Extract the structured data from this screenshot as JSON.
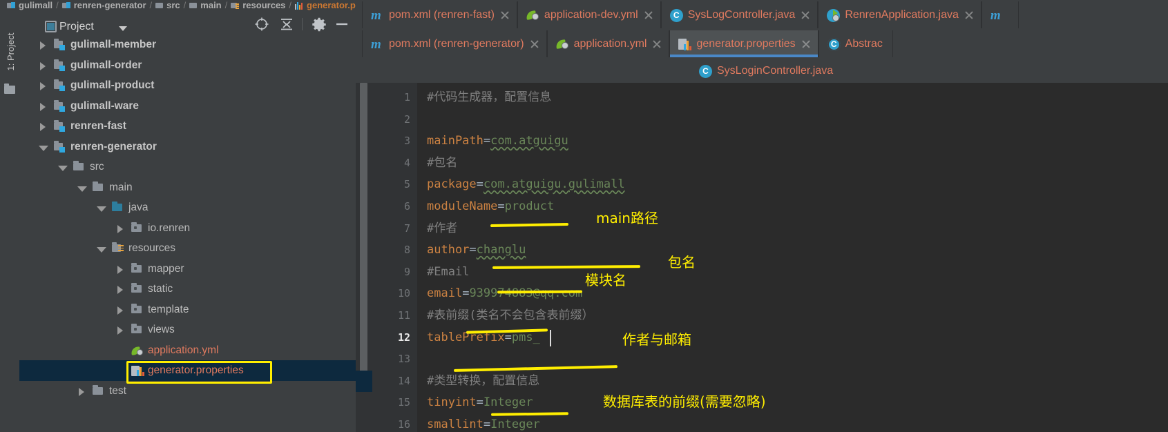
{
  "breadcrumb": {
    "items": [
      {
        "label": "gulimall",
        "icon": "module-icon"
      },
      {
        "label": "renren-generator",
        "icon": "module-icon"
      },
      {
        "label": "src",
        "icon": "folder-icon"
      },
      {
        "label": "main",
        "icon": "folder-icon"
      },
      {
        "label": "resources",
        "icon": "resources-folder-icon"
      },
      {
        "label": "generator.properties",
        "icon": "properties-file-icon"
      }
    ],
    "separator": "/"
  },
  "tool_window_strip": {
    "label": "1: Project",
    "underlined_char": "1",
    "folder_icon": "folder-icon"
  },
  "project_panel": {
    "title": "Project",
    "dropdown_icon": "chevron-down-icon",
    "toolbar_icons": [
      {
        "name": "locate-icon"
      },
      {
        "name": "collapse-all-icon"
      },
      {
        "name": "gear-icon"
      },
      {
        "name": "minimize-icon"
      }
    ],
    "tree": [
      {
        "label": "gulimall-member",
        "depth": 1,
        "arrow": "collapsed",
        "icon": "module-icon",
        "style": "bold"
      },
      {
        "label": "gulimall-order",
        "depth": 1,
        "arrow": "collapsed",
        "icon": "module-icon",
        "style": "bold"
      },
      {
        "label": "gulimall-product",
        "depth": 1,
        "arrow": "collapsed",
        "icon": "module-icon",
        "style": "bold"
      },
      {
        "label": "gulimall-ware",
        "depth": 1,
        "arrow": "collapsed",
        "icon": "module-icon",
        "style": "bold"
      },
      {
        "label": "renren-fast",
        "depth": 1,
        "arrow": "collapsed",
        "icon": "module-icon",
        "style": "bold"
      },
      {
        "label": "renren-generator",
        "depth": 1,
        "arrow": "expanded",
        "icon": "module-icon",
        "style": "bold"
      },
      {
        "label": "src",
        "depth": 2,
        "arrow": "expanded",
        "icon": "folder-icon",
        "style": "normal"
      },
      {
        "label": "main",
        "depth": 3,
        "arrow": "expanded",
        "icon": "folder-icon",
        "style": "normal"
      },
      {
        "label": "java",
        "depth": 4,
        "arrow": "expanded",
        "icon": "source-root-icon",
        "style": "normal"
      },
      {
        "label": "io.renren",
        "depth": 5,
        "arrow": "collapsed",
        "icon": "package-icon",
        "style": "normal"
      },
      {
        "label": "resources",
        "depth": 4,
        "arrow": "expanded",
        "icon": "resources-folder-icon",
        "style": "normal"
      },
      {
        "label": "mapper",
        "depth": 5,
        "arrow": "collapsed",
        "icon": "package-icon",
        "style": "normal"
      },
      {
        "label": "static",
        "depth": 5,
        "arrow": "collapsed",
        "icon": "package-icon",
        "style": "normal"
      },
      {
        "label": "template",
        "depth": 5,
        "arrow": "collapsed",
        "icon": "package-icon",
        "style": "normal"
      },
      {
        "label": "views",
        "depth": 5,
        "arrow": "collapsed",
        "icon": "package-icon",
        "style": "normal"
      },
      {
        "label": "application.yml",
        "depth": 5,
        "arrow": "none",
        "icon": "spring-yml-icon",
        "style": "yml"
      },
      {
        "label": "generator.properties",
        "depth": 5,
        "arrow": "none",
        "icon": "properties-file-icon",
        "style": "props",
        "selected": true,
        "annotated": true
      },
      {
        "label": "test",
        "depth": 3,
        "arrow": "collapsed",
        "icon": "folder-icon",
        "style": "normal"
      }
    ]
  },
  "editor": {
    "tab_rows": [
      [
        {
          "label": "pom.xml (renren-fast)",
          "icon": "maven-icon",
          "active": false,
          "closable": true
        },
        {
          "label": "application-dev.yml",
          "icon": "spring-yml-icon",
          "active": false,
          "closable": true
        },
        {
          "label": "SysLogController.java",
          "icon": "class-icon",
          "active": false,
          "closable": true
        },
        {
          "label": "RenrenApplication.java",
          "icon": "spring-boot-icon",
          "active": false,
          "closable": true
        },
        {
          "label": "m",
          "icon": "maven-icon",
          "active": false,
          "closable": false,
          "truncated": true
        }
      ],
      [
        {
          "label": "pom.xml (renren-generator)",
          "icon": "maven-icon",
          "active": false,
          "closable": true
        },
        {
          "label": "application.yml",
          "icon": "spring-yml-icon",
          "active": false,
          "closable": true
        },
        {
          "label": "generator.properties",
          "icon": "properties-file-icon",
          "active": true,
          "closable": true
        },
        {
          "label": "Abstrac",
          "icon": "abstract-class-icon",
          "active": false,
          "closable": false,
          "truncated": true
        }
      ],
      [
        {
          "label": "SysLoginController.java",
          "icon": "class-icon",
          "active": false,
          "closable": false
        }
      ]
    ],
    "code": {
      "lines": [
        {
          "num": "1",
          "tokens": [
            {
              "t": "#代码生成器，配置信息",
              "c": "comment"
            }
          ]
        },
        {
          "num": "2",
          "tokens": []
        },
        {
          "num": "3",
          "tokens": [
            {
              "t": "mainPath",
              "c": "key"
            },
            {
              "t": "=",
              "c": "equals"
            },
            {
              "t": "com.atguigu",
              "c": "value-warn"
            }
          ]
        },
        {
          "num": "4",
          "tokens": [
            {
              "t": "#包名",
              "c": "comment"
            }
          ]
        },
        {
          "num": "5",
          "tokens": [
            {
              "t": "package",
              "c": "key"
            },
            {
              "t": "=",
              "c": "equals"
            },
            {
              "t": "com.atguigu.gulimall",
              "c": "value-warn"
            }
          ]
        },
        {
          "num": "6",
          "tokens": [
            {
              "t": "moduleName",
              "c": "key"
            },
            {
              "t": "=",
              "c": "equals"
            },
            {
              "t": "product",
              "c": "value"
            }
          ]
        },
        {
          "num": "7",
          "tokens": [
            {
              "t": "#作者",
              "c": "comment"
            }
          ]
        },
        {
          "num": "8",
          "tokens": [
            {
              "t": "author",
              "c": "key"
            },
            {
              "t": "=",
              "c": "equals"
            },
            {
              "t": "changlu",
              "c": "value-warn"
            }
          ]
        },
        {
          "num": "9",
          "tokens": [
            {
              "t": "#Email",
              "c": "comment"
            }
          ]
        },
        {
          "num": "10",
          "tokens": [
            {
              "t": "email",
              "c": "key"
            },
            {
              "t": "=",
              "c": "equals"
            },
            {
              "t": "939974883@qq.com",
              "c": "value"
            }
          ]
        },
        {
          "num": "11",
          "tokens": [
            {
              "t": "#表前缀(类名不会包含表前缀）",
              "c": "comment"
            }
          ]
        },
        {
          "num": "12",
          "tokens": [
            {
              "t": "tablePrefix",
              "c": "key"
            },
            {
              "t": "=",
              "c": "equals"
            },
            {
              "t": "pms_",
              "c": "value"
            }
          ],
          "current": true
        },
        {
          "num": "13",
          "tokens": []
        },
        {
          "num": "14",
          "tokens": [
            {
              "t": "#类型转换，配置信息",
              "c": "comment"
            }
          ]
        },
        {
          "num": "15",
          "tokens": [
            {
              "t": "tinyint",
              "c": "key"
            },
            {
              "t": "=",
              "c": "equals"
            },
            {
              "t": "Integer",
              "c": "value"
            }
          ]
        },
        {
          "num": "16",
          "tokens": [
            {
              "t": "smallint",
              "c": "key"
            },
            {
              "t": "=",
              "c": "equals"
            },
            {
              "t": "Integer",
              "c": "value"
            }
          ]
        }
      ],
      "caret_line": "12",
      "caret_after": "pms_"
    },
    "annotations": [
      {
        "text": "main路径",
        "target_line": "3"
      },
      {
        "text": "包名",
        "target_line": "5"
      },
      {
        "text": "模块名",
        "target_line": "6"
      },
      {
        "text": "作者与邮箱",
        "target_line": "8"
      },
      {
        "text": "数据库表的前缀(需要忽略)",
        "target_line": "12"
      }
    ]
  },
  "colors": {
    "annotation": "#ffee00",
    "active_tab_underline": "#4a88c7",
    "selection": "#0d293e",
    "key": "#cc8242",
    "value": "#6a8759",
    "comment": "#808080",
    "filename": "#e07a5f",
    "editor_bg": "#2b2b2b",
    "panel_bg": "#3c3f41"
  }
}
